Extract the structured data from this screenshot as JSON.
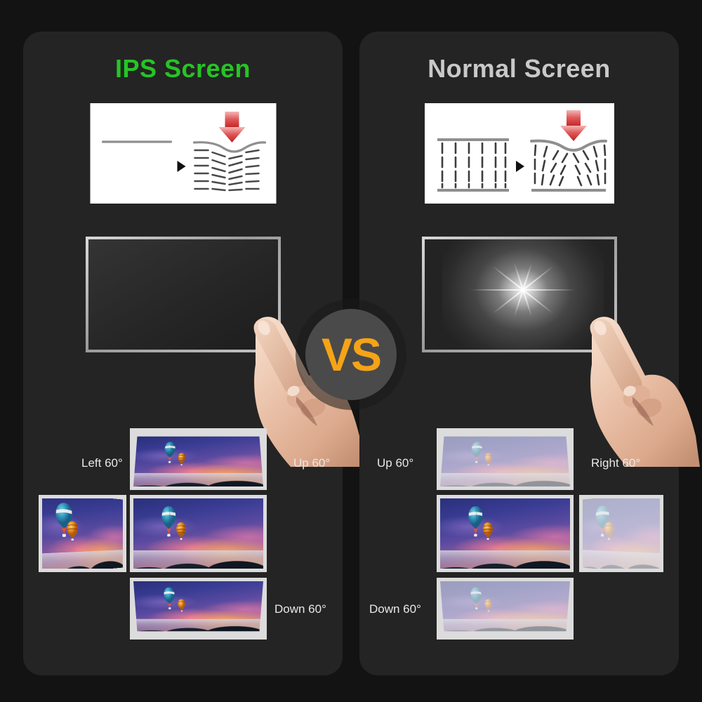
{
  "background": {
    "page_color": "#131313",
    "panel_color": "#242424"
  },
  "panels": [
    {
      "id": "ips",
      "title": "IPS Screen",
      "title_color": "#25c525",
      "crystal_diagram": {
        "name": "ips-crystal-alignment-diagram",
        "orientation": "horizontal",
        "description": "Horizontal liquid crystal alignment deforming under downward pressure arrow",
        "arrow_color": "#d93b3b"
      },
      "touch_test": {
        "name": "ips-touch-pressure-test",
        "result": "no-ripple",
        "screen_state": "uniform dark, no light bleed under finger pressure"
      },
      "viewing_angles": [
        {
          "position": "left",
          "label": "Left 60°",
          "quality": "vivid"
        },
        {
          "position": "up",
          "label": "Up 60°",
          "quality": "vivid"
        },
        {
          "position": "down",
          "label": "Down 60°",
          "quality": "vivid"
        },
        {
          "position": "center",
          "label": "",
          "quality": "vivid"
        }
      ]
    },
    {
      "id": "normal",
      "title": "Normal Screen",
      "title_color": "#c9c9c9",
      "crystal_diagram": {
        "name": "normal-crystal-alignment-diagram",
        "orientation": "vertical",
        "description": "Vertical liquid crystal alignment scattering under downward pressure arrow",
        "arrow_color": "#d93b3b"
      },
      "touch_test": {
        "name": "normal-touch-pressure-test",
        "result": "bright-ripple",
        "screen_state": "bright white starburst glow under finger pressure"
      },
      "viewing_angles": [
        {
          "position": "up",
          "label": "Up 60°",
          "quality": "washed-out"
        },
        {
          "position": "right",
          "label": "Right 60°",
          "quality": "washed-out"
        },
        {
          "position": "down",
          "label": "Down 60°",
          "quality": "washed-out"
        },
        {
          "position": "center",
          "label": "",
          "quality": "vivid"
        }
      ]
    }
  ],
  "vs_badge": {
    "label": "VS",
    "text_color": "#f5a317",
    "circle_color": "#4a4a4a"
  },
  "sample_image": {
    "name": "hot-air-balloon-sunset-photo",
    "description": "Two hot air balloons over a sunset sky with mountains"
  }
}
